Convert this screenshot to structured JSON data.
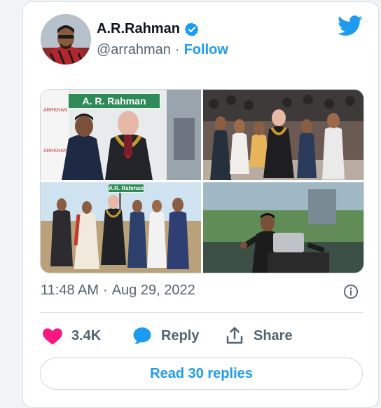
{
  "author": {
    "name": "A.R.Rahman",
    "handle": "@arrahman",
    "separator": "·",
    "follow_label": "Follow",
    "verified": true
  },
  "media": {
    "sign_main": "A. R. Rahman",
    "sign_small": "A.R. Rahman",
    "backdrop_logo": "ARRKHAN"
  },
  "tweet": {
    "time": "11:48 AM",
    "separator": "·",
    "date": "Aug 29, 2022"
  },
  "actions": {
    "likes": "3.4K",
    "reply_label": "Reply",
    "share_label": "Share"
  },
  "read_replies_label": "Read 30 replies",
  "colors": {
    "brand_blue": "#1d9bf0",
    "like_pink": "#f91880",
    "muted_text": "#536471"
  }
}
